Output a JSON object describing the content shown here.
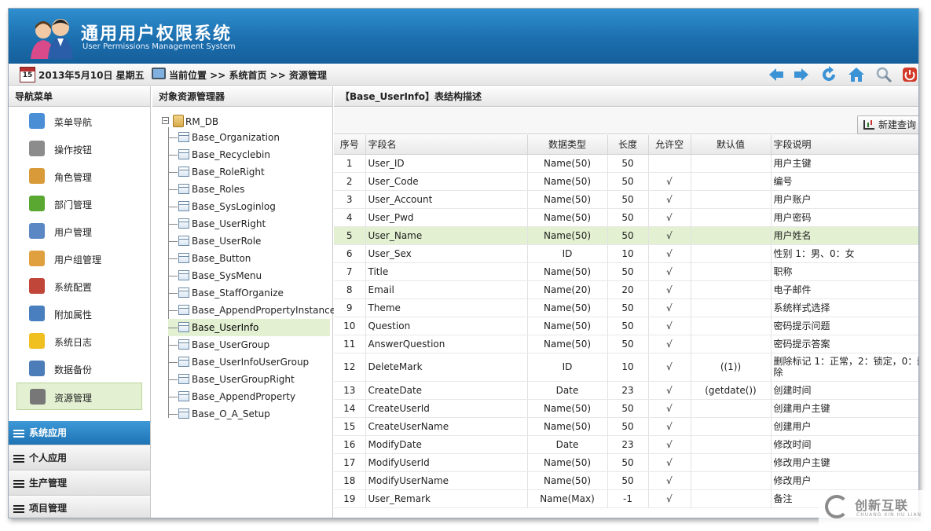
{
  "header": {
    "title": "通用用户权限系统",
    "subtitle": "User Permissions Management System"
  },
  "toolbar": {
    "date_icon_day": "15",
    "date": "2013年5月10日 星期五",
    "location": "当前位置 >> 系统首页 >> 资源管理",
    "buttons": [
      "arrow-left-icon",
      "arrow-right-icon",
      "refresh-icon",
      "home-icon",
      "search-icon",
      "power-icon"
    ]
  },
  "nav": {
    "title": "导航菜单",
    "items": [
      {
        "label": "菜单导航",
        "icon": "menu-tree-icon",
        "color": "#4a8fd6"
      },
      {
        "label": "操作按钮",
        "icon": "wrench-icon",
        "color": "#8c8c8c"
      },
      {
        "label": "角色管理",
        "icon": "users-role-icon",
        "color": "#d99a3a"
      },
      {
        "label": "部门管理",
        "icon": "department-icon",
        "color": "#5aa732"
      },
      {
        "label": "用户管理",
        "icon": "user-card-icon",
        "color": "#5b87c5"
      },
      {
        "label": "用户组管理",
        "icon": "user-group-icon",
        "color": "#e0a040"
      },
      {
        "label": "系统配置",
        "icon": "tools-icon",
        "color": "#c0463a"
      },
      {
        "label": "附加属性",
        "icon": "book-icon",
        "color": "#4a7fbf"
      },
      {
        "label": "系统日志",
        "icon": "warning-icon",
        "color": "#f0c020"
      },
      {
        "label": "数据备份",
        "icon": "backup-icon",
        "color": "#4d7db8"
      },
      {
        "label": "资源管理",
        "icon": "database-icon",
        "color": "#777777"
      }
    ],
    "active_index": 10,
    "sections": [
      "系统应用",
      "个人应用",
      "生产管理",
      "项目管理"
    ],
    "selected_section": 0
  },
  "tree": {
    "title": "对象资源管理器",
    "root": "RM_DB",
    "items": [
      "Base_Organization",
      "Base_Recyclebin",
      "Base_RoleRight",
      "Base_Roles",
      "Base_SysLoginlog",
      "Base_UserRight",
      "Base_UserRole",
      "Base_Button",
      "Base_SysMenu",
      "Base_StaffOrganize",
      "Base_AppendPropertyInstance",
      "Base_UserInfo",
      "Base_UserGroup",
      "Base_UserInfoUserGroup",
      "Base_UserGroupRight",
      "Base_AppendProperty",
      "Base_O_A_Setup"
    ],
    "selected_index": 11
  },
  "main": {
    "title": "【Base_UserInfo】表结构描述",
    "new_query_label": "新建查询",
    "columns": [
      "序号",
      "字段名",
      "数据类型",
      "长度",
      "允许空",
      "默认值",
      "字段说明"
    ],
    "highlighted_row": 4,
    "rows": [
      [
        "1",
        "User_ID",
        "Name(50)",
        "50",
        "",
        "",
        "用户主键"
      ],
      [
        "2",
        "User_Code",
        "Name(50)",
        "50",
        "√",
        "",
        "编号"
      ],
      [
        "3",
        "User_Account",
        "Name(50)",
        "50",
        "√",
        "",
        "用户账户"
      ],
      [
        "4",
        "User_Pwd",
        "Name(50)",
        "50",
        "√",
        "",
        "用户密码"
      ],
      [
        "5",
        "User_Name",
        "Name(50)",
        "50",
        "√",
        "",
        "用户姓名"
      ],
      [
        "6",
        "User_Sex",
        "ID",
        "10",
        "√",
        "",
        "性别 1：男、0：女"
      ],
      [
        "7",
        "Title",
        "Name(50)",
        "50",
        "√",
        "",
        "职称"
      ],
      [
        "8",
        "Email",
        "Name(20)",
        "20",
        "√",
        "",
        "电子邮件"
      ],
      [
        "9",
        "Theme",
        "Name(50)",
        "50",
        "√",
        "",
        "系统样式选择"
      ],
      [
        "10",
        "Question",
        "Name(50)",
        "50",
        "√",
        "",
        "密码提示问题"
      ],
      [
        "11",
        "AnswerQuestion",
        "Name(50)",
        "50",
        "√",
        "",
        "密码提示答案"
      ],
      [
        "12",
        "DeleteMark",
        "ID",
        "10",
        "√",
        "((1))",
        "删除标记 1：正常，2：锁定，0：删除"
      ],
      [
        "13",
        "CreateDate",
        "Date",
        "23",
        "√",
        "(getdate())",
        "创建时间"
      ],
      [
        "14",
        "CreateUserId",
        "Name(50)",
        "50",
        "√",
        "",
        "创建用户主键"
      ],
      [
        "15",
        "CreateUserName",
        "Name(50)",
        "50",
        "√",
        "",
        "创建用户"
      ],
      [
        "16",
        "ModifyDate",
        "Date",
        "23",
        "√",
        "",
        "修改时间"
      ],
      [
        "17",
        "ModifyUserId",
        "Name(50)",
        "50",
        "√",
        "",
        "修改用户主键"
      ],
      [
        "18",
        "ModifyUserName",
        "Name(50)",
        "50",
        "√",
        "",
        "修改用户"
      ],
      [
        "19",
        "User_Remark",
        "Name(Max)",
        "-1",
        "√",
        "",
        "备注"
      ]
    ]
  },
  "watermark": {
    "text": "创新互联",
    "sub": "CHUANG XIN HU LIAN"
  }
}
